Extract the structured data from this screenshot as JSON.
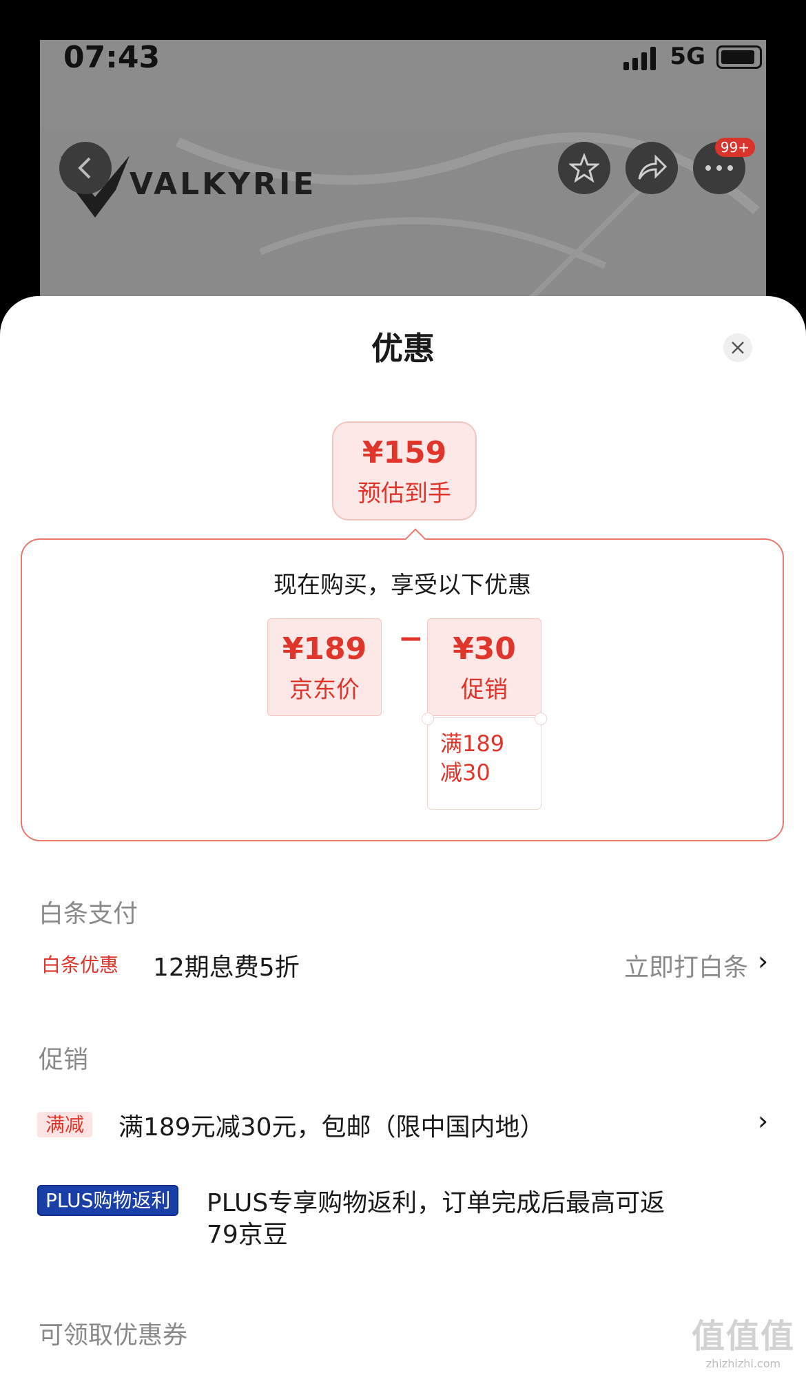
{
  "status_bar": {
    "time": "07:43",
    "network": "5G"
  },
  "background_page": {
    "brand": "VALKYRIE",
    "more_badge": "99+"
  },
  "sheet": {
    "title": "优惠",
    "estimate": {
      "price": "¥159",
      "label": "预估到手"
    },
    "breakdown": {
      "title": "现在购买，享受以下优惠",
      "jd_price": {
        "value": "¥189",
        "label": "京东价"
      },
      "operator": "−",
      "promo": {
        "value": "¥30",
        "label": "促销",
        "condition_line1": "满189",
        "condition_line2": "减30"
      }
    },
    "baitiao": {
      "section_title": "白条支付",
      "tag": "白条优惠",
      "text": "12期息费5折",
      "action": "立即打白条",
      "chevron": "›"
    },
    "promotion": {
      "section_title": "促销",
      "items": [
        {
          "tag": "满减",
          "text": "满189元减30元，包邮（限中国内地）",
          "chevron": "›"
        },
        {
          "tag": "PLUS购物返利",
          "text_line1": "PLUS专享购物返利，订单完成后最高可返",
          "text_line2": "79京豆"
        }
      ]
    },
    "coupons": {
      "section_title": "可领取优惠券"
    }
  },
  "watermark": {
    "big": "值值值",
    "small": "zhizhizhi.com"
  },
  "colors": {
    "accent": "#e0352b",
    "tag_bg": "#fce8e6",
    "plus": "#1a3fa8"
  }
}
